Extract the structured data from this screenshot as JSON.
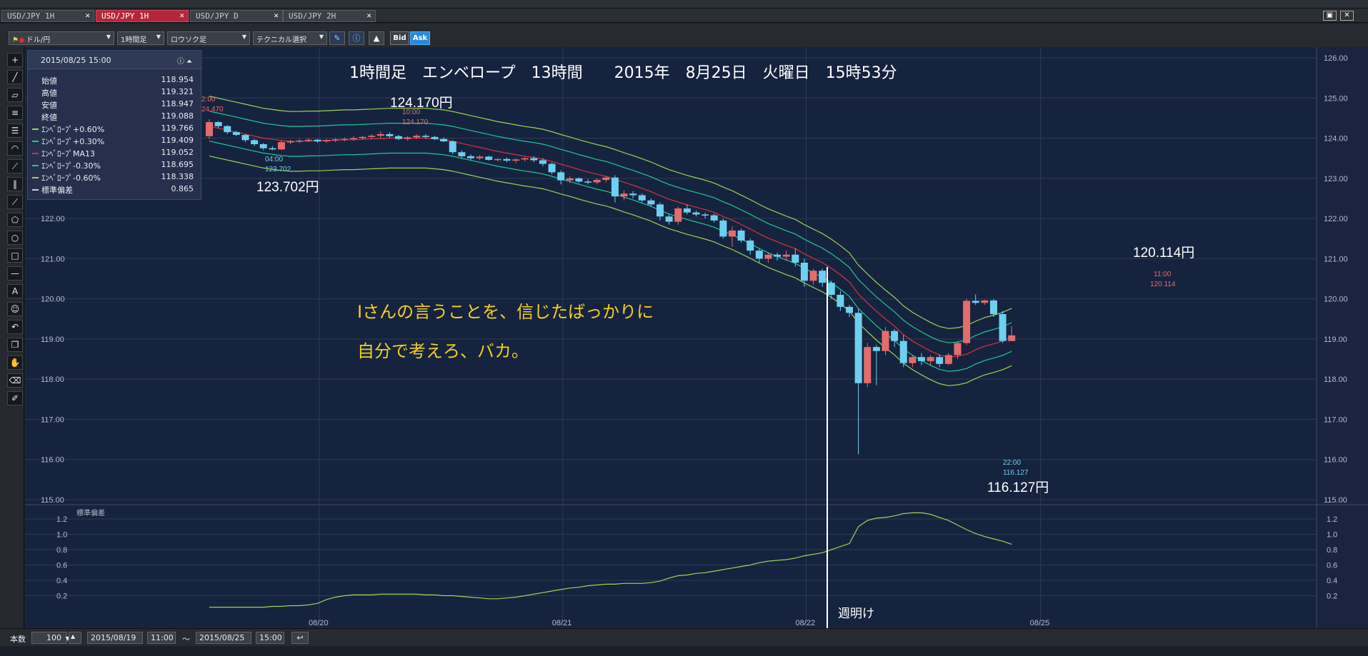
{
  "tabs": [
    {
      "label": "USD/JPY 1H",
      "active": false
    },
    {
      "label": "USD/JPY 1H",
      "active": true
    },
    {
      "label": "USD/JPY D",
      "active": false
    },
    {
      "label": "USD/JPY 2H",
      "active": false
    }
  ],
  "tab_close": "✕",
  "toolbar": {
    "pair": "ドル/円",
    "timeframe": "1時間足",
    "chart_kind": "ロウソク足",
    "technical": "テクニカル選択",
    "bid": "Bid",
    "ask": "Ask"
  },
  "info": {
    "datetime": "2015/08/25 15:00",
    "rows": [
      {
        "label": "始値",
        "value": "118.954"
      },
      {
        "label": "高値",
        "value": "119.321"
      },
      {
        "label": "安値",
        "value": "118.947"
      },
      {
        "label": "終値",
        "value": "119.088"
      },
      {
        "label": "ｴﾝﾍﾞﾛｰﾌﾟ+0.60%",
        "value": "119.766",
        "color": "#9bd455"
      },
      {
        "label": "ｴﾝﾍﾞﾛｰﾌﾟ+0.30%",
        "value": "119.409",
        "color": "#1fc89a"
      },
      {
        "label": "ｴﾝﾍﾞﾛｰﾌﾟMA13",
        "value": "119.052",
        "color": "#d8323c"
      },
      {
        "label": "ｴﾝﾍﾞﾛｰﾌﾟ-0.30%",
        "value": "118.695",
        "color": "#1fc89a"
      },
      {
        "label": "ｴﾝﾍﾞﾛｰﾌﾟ-0.60%",
        "value": "118.338",
        "color": "#9bd455"
      },
      {
        "label": "標準偏差",
        "value": "0.865",
        "color": "#c8d0dc"
      }
    ]
  },
  "annotations": {
    "headline": "1時間足　エンベロープ　13時間　　2015年　8月25日　火曜日　15時53分",
    "high_price": "124.170円",
    "low1_price": "123.702円",
    "low2_price": "116.127円",
    "high2_price": "120.114円",
    "message1": "Iさんの言うことを、信じたばっかりに",
    "message2": "自分で考えろ、バカ。",
    "week_open": "週明け",
    "mark_high_time": "10:00",
    "mark_high_val": "124.170",
    "mark_low1_time": "04:00",
    "mark_low1_val": "123.702",
    "mark_low2_time": "22:00",
    "mark_low2_val": "116.127",
    "mark_high2_time": "11:00",
    "mark_high2_val": "120.114",
    "mark_partial_time": "2:00",
    "mark_partial_val": "24.470"
  },
  "sub_label": "標準偏差",
  "bottom": {
    "count_label": "本数",
    "count_value": "100",
    "from_date": "2015/08/19",
    "from_time": "11:00",
    "tilde": "～",
    "to_date": "2015/08/25",
    "to_time": "15:00"
  },
  "colors": {
    "bg": "#16233f",
    "grid": "#2e3b57",
    "up": "#e46c6c",
    "down": "#6ed0f0",
    "env_outer": "#9bd455",
    "env_inner": "#1fc89a",
    "ma": "#d8323c",
    "annotation": "#f2d021"
  },
  "chart_data": {
    "type": "candlestick",
    "price_axis": {
      "ylim": [
        115,
        126
      ],
      "ticks": [
        "126.00",
        "125.00",
        "124.00",
        "123.00",
        "122.00",
        "121.00",
        "120.00",
        "119.00",
        "118.00",
        "117.00",
        "116.00",
        "115.00"
      ]
    },
    "sub_axis": {
      "ylim": [
        0,
        1.3
      ],
      "ticks": [
        "1.2",
        "1.0",
        "0.8",
        "0.6",
        "0.4",
        "0.2"
      ]
    },
    "x_labels": [
      {
        "label": "08/20",
        "index": 13
      },
      {
        "label": "08/21",
        "index": 40
      },
      {
        "label": "08/22",
        "index": 67
      },
      {
        "label": "08/25",
        "index": 93
      }
    ],
    "candles": [
      [
        124.05,
        124.47,
        123.98,
        124.4
      ],
      [
        124.4,
        124.42,
        124.25,
        124.3
      ],
      [
        124.3,
        124.32,
        124.1,
        124.15
      ],
      [
        124.15,
        124.18,
        124.05,
        124.08
      ],
      [
        124.08,
        124.1,
        123.9,
        123.95
      ],
      [
        123.95,
        123.98,
        123.8,
        123.85
      ],
      [
        123.85,
        123.88,
        123.7,
        123.75
      ],
      [
        123.75,
        123.8,
        123.7,
        123.72
      ],
      [
        123.72,
        123.95,
        123.7,
        123.9
      ],
      [
        123.9,
        123.96,
        123.85,
        123.92
      ],
      [
        123.92,
        123.98,
        123.88,
        123.94
      ],
      [
        123.94,
        124.0,
        123.9,
        123.96
      ],
      [
        123.96,
        123.98,
        123.88,
        123.92
      ],
      [
        123.92,
        123.98,
        123.88,
        123.95
      ],
      [
        123.95,
        124.0,
        123.9,
        123.97
      ],
      [
        123.97,
        124.02,
        123.92,
        123.98
      ],
      [
        123.98,
        124.05,
        123.94,
        124.0
      ],
      [
        124.0,
        124.06,
        123.96,
        124.03
      ],
      [
        124.03,
        124.1,
        123.98,
        124.06
      ],
      [
        124.06,
        124.17,
        124.0,
        124.1
      ],
      [
        124.1,
        124.15,
        124.0,
        124.05
      ],
      [
        124.05,
        124.08,
        123.95,
        123.98
      ],
      [
        123.98,
        124.05,
        123.94,
        124.02
      ],
      [
        124.02,
        124.1,
        123.98,
        124.06
      ],
      [
        124.06,
        124.1,
        123.98,
        124.03
      ],
      [
        124.03,
        124.06,
        123.95,
        123.98
      ],
      [
        123.98,
        124.02,
        123.9,
        123.92
      ],
      [
        123.92,
        123.95,
        123.6,
        123.65
      ],
      [
        123.65,
        123.7,
        123.5,
        123.55
      ],
      [
        123.55,
        123.6,
        123.45,
        123.5
      ],
      [
        123.5,
        123.58,
        123.45,
        123.54
      ],
      [
        123.54,
        123.56,
        123.44,
        123.46
      ],
      [
        123.46,
        123.5,
        123.42,
        123.48
      ],
      [
        123.48,
        123.52,
        123.4,
        123.44
      ],
      [
        123.44,
        123.5,
        123.38,
        123.47
      ],
      [
        123.47,
        123.52,
        123.42,
        123.5
      ],
      [
        123.5,
        123.55,
        123.4,
        123.45
      ],
      [
        123.45,
        123.5,
        123.3,
        123.36
      ],
      [
        123.36,
        123.4,
        123.1,
        123.15
      ],
      [
        123.15,
        123.2,
        122.85,
        122.95
      ],
      [
        122.95,
        123.05,
        122.88,
        123.0
      ],
      [
        123.0,
        123.02,
        122.88,
        122.92
      ],
      [
        122.92,
        122.98,
        122.85,
        122.9
      ],
      [
        122.9,
        123.0,
        122.85,
        122.96
      ],
      [
        122.96,
        123.05,
        122.9,
        123.02
      ],
      [
        123.02,
        123.08,
        122.4,
        122.55
      ],
      [
        122.55,
        122.7,
        122.45,
        122.62
      ],
      [
        122.62,
        122.68,
        122.5,
        122.58
      ],
      [
        122.58,
        122.62,
        122.4,
        122.45
      ],
      [
        122.45,
        122.5,
        122.3,
        122.35
      ],
      [
        122.35,
        122.4,
        121.95,
        122.05
      ],
      [
        122.05,
        122.1,
        121.85,
        121.92
      ],
      [
        121.92,
        122.3,
        121.85,
        122.25
      ],
      [
        122.25,
        122.35,
        122.1,
        122.15
      ],
      [
        122.15,
        122.2,
        122.05,
        122.1
      ],
      [
        122.1,
        122.15,
        122.0,
        122.08
      ],
      [
        122.08,
        122.12,
        121.9,
        121.95
      ],
      [
        121.95,
        122.0,
        121.5,
        121.55
      ],
      [
        121.55,
        121.8,
        121.3,
        121.7
      ],
      [
        121.7,
        121.75,
        121.4,
        121.45
      ],
      [
        121.45,
        121.5,
        121.1,
        121.2
      ],
      [
        121.2,
        121.25,
        120.9,
        121.0
      ],
      [
        121.0,
        121.15,
        120.9,
        121.1
      ],
      [
        121.1,
        121.15,
        120.95,
        121.05
      ],
      [
        121.05,
        121.2,
        120.95,
        121.1
      ],
      [
        121.1,
        121.25,
        120.8,
        120.9
      ],
      [
        120.9,
        121.0,
        120.3,
        120.45
      ],
      [
        120.45,
        120.75,
        120.35,
        120.7
      ],
      [
        120.7,
        120.75,
        120.3,
        120.4
      ],
      [
        120.4,
        120.45,
        120.0,
        120.1
      ],
      [
        120.1,
        120.2,
        119.7,
        119.8
      ],
      [
        119.8,
        119.85,
        119.55,
        119.65
      ],
      [
        119.65,
        119.75,
        116.13,
        117.9
      ],
      [
        117.9,
        118.9,
        117.8,
        118.8
      ],
      [
        118.8,
        118.85,
        117.85,
        118.7
      ],
      [
        118.7,
        119.3,
        118.6,
        119.2
      ],
      [
        119.2,
        119.25,
        118.8,
        118.95
      ],
      [
        118.95,
        119.1,
        118.3,
        118.4
      ],
      [
        118.4,
        118.6,
        118.3,
        118.55
      ],
      [
        118.55,
        118.65,
        118.35,
        118.45
      ],
      [
        118.45,
        118.6,
        118.35,
        118.55
      ],
      [
        118.55,
        118.62,
        118.3,
        118.38
      ],
      [
        118.38,
        118.65,
        118.35,
        118.6
      ],
      [
        118.6,
        118.95,
        118.5,
        118.9
      ],
      [
        118.9,
        120.0,
        118.85,
        119.95
      ],
      [
        119.95,
        120.11,
        119.85,
        119.9
      ],
      [
        119.9,
        119.98,
        119.85,
        119.96
      ],
      [
        119.96,
        120.0,
        119.55,
        119.62
      ],
      [
        119.62,
        119.7,
        118.9,
        118.95
      ],
      [
        118.95,
        119.32,
        118.95,
        119.09
      ]
    ],
    "ma13": [
      124.3,
      124.25,
      124.2,
      124.15,
      124.1,
      124.05,
      124.0,
      123.97,
      123.94,
      123.92,
      123.92,
      123.93,
      123.93,
      123.94,
      123.95,
      123.96,
      123.96,
      123.97,
      123.98,
      123.99,
      124.0,
      124.0,
      124.0,
      124.0,
      124.0,
      123.98,
      123.96,
      123.92,
      123.87,
      123.82,
      123.77,
      123.72,
      123.67,
      123.63,
      123.59,
      123.55,
      123.52,
      123.48,
      123.42,
      123.35,
      123.29,
      123.22,
      123.16,
      123.1,
      123.05,
      122.98,
      122.9,
      122.83,
      122.75,
      122.67,
      122.57,
      122.48,
      122.41,
      122.34,
      122.28,
      122.22,
      122.15,
      122.05,
      121.96,
      121.85,
      121.74,
      121.62,
      121.51,
      121.42,
      121.33,
      121.25,
      121.12,
      121.01,
      120.9,
      120.76,
      120.6,
      120.42,
      120.12,
      119.9,
      119.69,
      119.5,
      119.32,
      119.11,
      118.95,
      118.82,
      118.7,
      118.6,
      118.55,
      118.57,
      118.62,
      118.73,
      118.82,
      118.88,
      118.95,
      119.05
    ]
  },
  "sub_data": [
    0.05,
    0.05,
    0.05,
    0.05,
    0.05,
    0.05,
    0.05,
    0.06,
    0.06,
    0.07,
    0.07,
    0.08,
    0.1,
    0.15,
    0.18,
    0.2,
    0.21,
    0.21,
    0.21,
    0.22,
    0.22,
    0.22,
    0.22,
    0.22,
    0.21,
    0.21,
    0.2,
    0.2,
    0.19,
    0.18,
    0.17,
    0.16,
    0.16,
    0.17,
    0.18,
    0.2,
    0.22,
    0.24,
    0.26,
    0.28,
    0.3,
    0.31,
    0.33,
    0.34,
    0.35,
    0.35,
    0.36,
    0.36,
    0.36,
    0.37,
    0.39,
    0.43,
    0.46,
    0.47,
    0.49,
    0.5,
    0.52,
    0.54,
    0.56,
    0.58,
    0.6,
    0.63,
    0.65,
    0.66,
    0.67,
    0.69,
    0.72,
    0.74,
    0.76,
    0.8,
    0.84,
    0.88,
    1.1,
    1.18,
    1.21,
    1.22,
    1.24,
    1.27,
    1.28,
    1.28,
    1.26,
    1.22,
    1.18,
    1.12,
    1.06,
    1.01,
    0.97,
    0.94,
    0.91,
    0.87
  ]
}
